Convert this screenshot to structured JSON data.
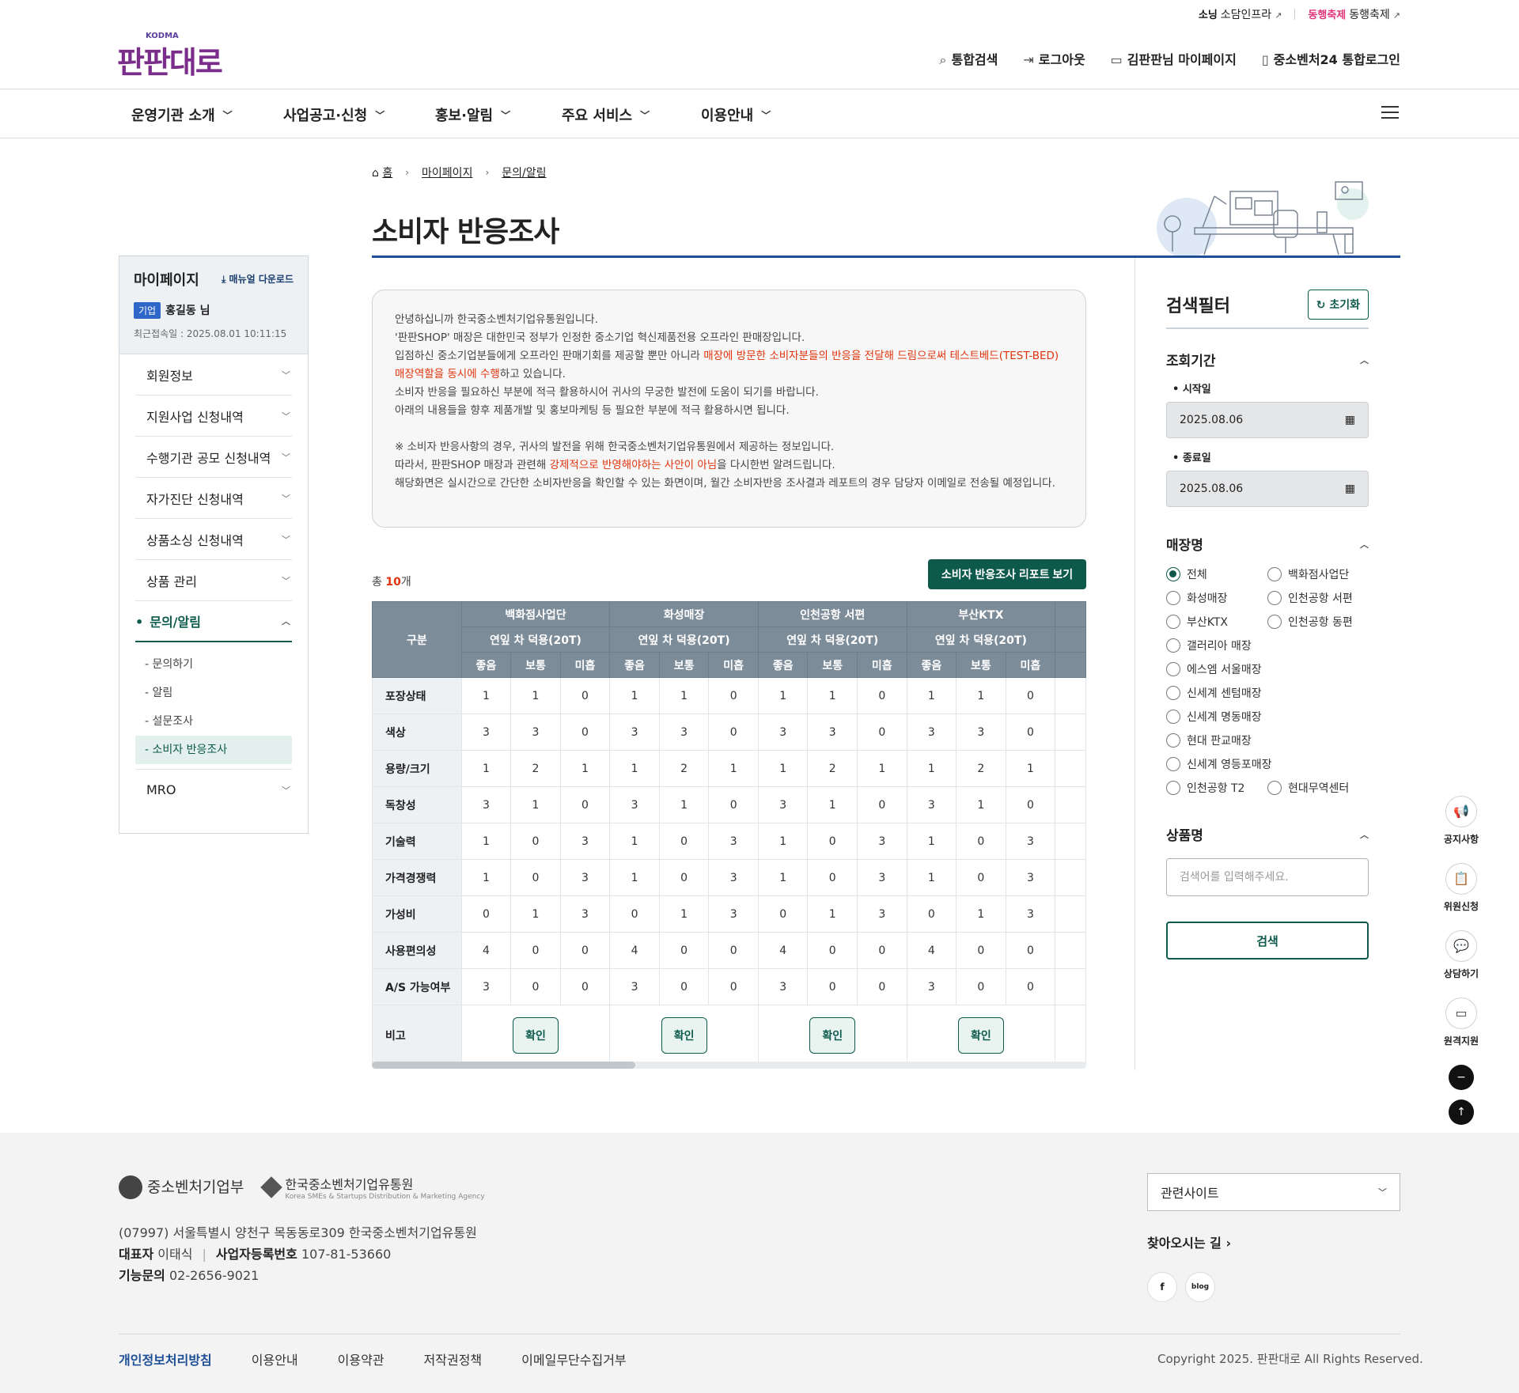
{
  "util": {
    "item1": "소담인프라",
    "item2": "동행축제",
    "brand1": "소닝",
    "brand2": "동행축제"
  },
  "header": {
    "logo": "판판대로",
    "logo_sub": "KODMA",
    "search": "통합검색",
    "logout": "로그아웃",
    "mypage": "김판판님 마이페이지",
    "login24": "중소벤처24 통합로그인"
  },
  "gnb": [
    "운영기관 소개",
    "사업공고·신청",
    "홍보·알림",
    "주요 서비스",
    "이용안내"
  ],
  "breadcrumb": {
    "home": "홈",
    "l1": "마이페이지",
    "l2": "문의/알림"
  },
  "page_title": "소비자 반응조사",
  "sidebar": {
    "title": "마이페이지",
    "manual": "매뉴얼 다운로드",
    "badge": "기업",
    "name": "홍길동 님",
    "last_login": "최근접속일 : 2025.08.01 10:11:15",
    "items": [
      "회원정보",
      "지원사업 신청내역",
      "수행기관 공모 신청내역",
      "자가진단 신청내역",
      "상품소싱 신청내역",
      "상품 관리"
    ],
    "active": "문의/알림",
    "sub": [
      "- 문의하기",
      "- 알림",
      "- 설문조사",
      "- 소비자 반응조사"
    ],
    "mro": "MRO"
  },
  "notice": {
    "l1": "안녕하십니까 한국중소벤처기업유통원입니다.",
    "l2": "'판판SHOP' 매장은 대한민국 정부가 인정한 중소기업 혁신제품전용 오프라인 판매장입니다.",
    "l3a": "입점하신 중소기업분들에게 오프라인 판매기회를 제공할 뿐만 아니라 ",
    "l3b": "매장에 방문한 소비자분들의 반응을 전달해 드림으로써 테스트베드(TEST-BED) 매장역할을 동시에 수행",
    "l3c": "하고 있습니다.",
    "l4": "소비자 반응을 필요하신 부분에 적극 활용하시어 귀사의 무궁한 발전에 도움이 되기를 바랍니다.",
    "l5": "아래의 내용들을 향후 제품개발 및 홍보마케팅 등 필요한 부분에 적극 활용하시면 됩니다.",
    "l6": "※ 소비자 반응사항의 경우, 귀사의 발전을 위해 한국중소벤처기업유통원에서 제공하는 정보입니다.",
    "l7a": "따라서, 판판SHOP 매장과 관련해 ",
    "l7b": "강제적으로 반영해야하는 사안이 아님",
    "l7c": "을 다시한번 알려드립니다.",
    "l8": "해당화면은 실시간으로 간단한 소비자반응을 확인할 수 있는 화면이며, 월간 소비자반응 조사결과 레포트의 경우 담당자 이메일로 전송될 예정입니다."
  },
  "total": {
    "pre": "총 ",
    "count": "10",
    "post": "개"
  },
  "report_button": "소비자 반응조사 리포트 보기",
  "table": {
    "corner": "구분",
    "stores": [
      "백화점사업단",
      "화성매장",
      "인천공항 서편",
      "부산KTX"
    ],
    "product": "연잎 차 덕용(20T)",
    "ratings": [
      "좋음",
      "보통",
      "미흡"
    ],
    "rows": [
      {
        "label": "포장상태",
        "vals": [
          "1",
          "1",
          "0"
        ]
      },
      {
        "label": "색상",
        "vals": [
          "3",
          "3",
          "0"
        ]
      },
      {
        "label": "용량/크기",
        "vals": [
          "1",
          "2",
          "1"
        ]
      },
      {
        "label": "독창성",
        "vals": [
          "3",
          "1",
          "0"
        ]
      },
      {
        "label": "기술력",
        "vals": [
          "1",
          "0",
          "3"
        ]
      },
      {
        "label": "가격경쟁력",
        "vals": [
          "1",
          "0",
          "3"
        ]
      },
      {
        "label": "가성비",
        "vals": [
          "0",
          "1",
          "3"
        ]
      },
      {
        "label": "사용편의성",
        "vals": [
          "4",
          "0",
          "0"
        ]
      },
      {
        "label": "A/S 가능여부",
        "vals": [
          "3",
          "0",
          "0"
        ]
      }
    ],
    "note_label": "비고",
    "confirm": "확인"
  },
  "filter": {
    "title": "검색필터",
    "reset": "초기화",
    "period": "조회기간",
    "start_label": "시작일",
    "start": "2025.08.06",
    "end_label": "종료일",
    "end": "2025.08.06",
    "store_title": "매장명",
    "stores": [
      "전체",
      "백화점사업단",
      "화성매장",
      "인천공항 서편",
      "부산KTX",
      "인천공항 동편",
      "갤러리아 매장",
      "에스엠 서울매장",
      "신세계 센텀매장",
      "신세계 명동매장",
      "현대 판교매장",
      "신세계 영등포매장",
      "인천공항 T2",
      "현대무역센터"
    ],
    "product_title": "상품명",
    "product_placeholder": "검색어를 입력해주세요.",
    "search": "검색"
  },
  "quick": [
    "공지사항",
    "위원신청",
    "상담하기",
    "원격지원"
  ],
  "footer": {
    "org1": "중소벤처기업부",
    "org2": "한국중소벤처기업유통원",
    "org2_sub": "Korea SMEs & Startups Distribution & Marketing Agency",
    "address": "(07997) 서울특별시 양천구 목동동로309 한국중소벤처기업유통원",
    "rep_label": "대표자",
    "rep": "이태식",
    "biz_label": "사업자등록번호",
    "biz": "107-81-53660",
    "tel_label": "기능문의",
    "tel": "02-2656-9021",
    "related": "관련사이트",
    "way": "찾아오시는 길",
    "links": [
      "개인정보처리방침",
      "이용안내",
      "이용약관",
      "저작권정책",
      "이메일무단수집거부"
    ],
    "copyright": "Copyright 2025. 판판대로 All Rights Reserved."
  }
}
